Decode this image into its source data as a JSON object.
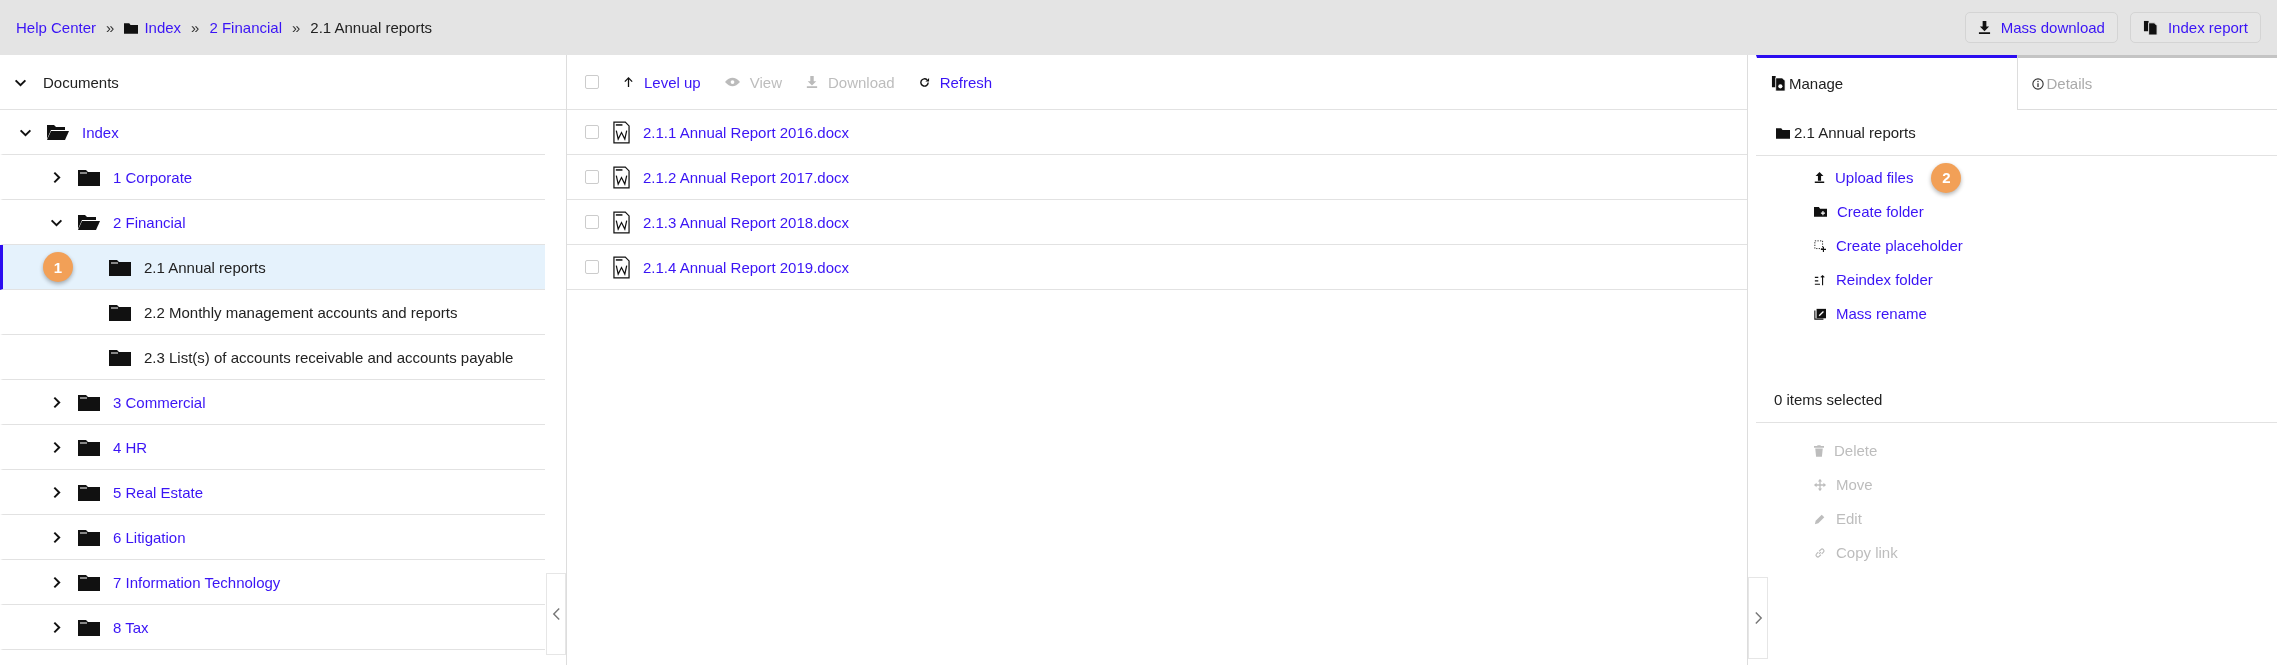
{
  "breadcrumb": {
    "separator": "»",
    "items": [
      {
        "label": "Help Center",
        "link": true,
        "folder_icon": false
      },
      {
        "label": "Index",
        "link": true,
        "folder_icon": true
      },
      {
        "label": "2 Financial",
        "link": true,
        "folder_icon": false
      },
      {
        "label": "2.1 Annual reports",
        "link": false,
        "folder_icon": false
      }
    ]
  },
  "header_buttons": [
    {
      "label": "Mass download",
      "kind": "download"
    },
    {
      "label": "Index report",
      "kind": "report"
    }
  ],
  "tree": {
    "title": "Documents",
    "expanded": true,
    "items": [
      {
        "label": "Index",
        "link": true,
        "selected": false,
        "expanded": true,
        "children": [
          {
            "label": "1 Corporate",
            "link": true,
            "selected": false,
            "expanded": false
          },
          {
            "label": "2 Financial",
            "link": true,
            "selected": false,
            "expanded": true,
            "children": [
              {
                "label": "2.1 Annual reports",
                "link": false,
                "selected": true,
                "callout": "1"
              },
              {
                "label": "2.2 Monthly management accounts and reports",
                "link": false,
                "selected": false
              },
              {
                "label": "2.3 List(s) of accounts receivable and accounts payable",
                "link": false,
                "selected": false
              }
            ]
          },
          {
            "label": "3 Commercial",
            "link": true,
            "selected": false,
            "expanded": false
          },
          {
            "label": "4 HR",
            "link": true,
            "selected": false,
            "expanded": false
          },
          {
            "label": "5 Real Estate",
            "link": true,
            "selected": false,
            "expanded": false
          },
          {
            "label": "6 Litigation",
            "link": true,
            "selected": false,
            "expanded": false
          },
          {
            "label": "7 Information Technology",
            "link": true,
            "selected": false,
            "expanded": false
          },
          {
            "label": "8 Tax",
            "link": true,
            "selected": false,
            "expanded": false
          }
        ]
      }
    ]
  },
  "toolbar": {
    "select_all_checked": false,
    "actions": [
      {
        "label": "Level up",
        "kind": "up",
        "disabled": false
      },
      {
        "label": "View",
        "kind": "view",
        "disabled": true
      },
      {
        "label": "Download",
        "kind": "download",
        "disabled": true
      },
      {
        "label": "Refresh",
        "kind": "refresh",
        "disabled": false
      }
    ]
  },
  "files": [
    {
      "name": "2.1.1 Annual Report 2016.docx",
      "checked": false
    },
    {
      "name": "2.1.2 Annual Report 2017.docx",
      "checked": false
    },
    {
      "name": "2.1.3 Annual Report 2018.docx",
      "checked": false
    },
    {
      "name": "2.1.4 Annual Report 2019.docx",
      "checked": false
    }
  ],
  "side_panel": {
    "tabs": [
      {
        "label": "Manage",
        "kind": "manage",
        "selected": true
      },
      {
        "label": "Details",
        "kind": "details",
        "selected": false
      }
    ],
    "folder": "2.1 Annual reports",
    "folder_actions": [
      {
        "label": "Upload files",
        "kind": "upload",
        "disabled": false,
        "callout": "2"
      },
      {
        "label": "Create folder",
        "kind": "folder",
        "disabled": false
      },
      {
        "label": "Create placeholder",
        "kind": "placeholder",
        "disabled": false
      },
      {
        "label": "Reindex folder",
        "kind": "reindex",
        "disabled": false
      },
      {
        "label": "Mass rename",
        "kind": "rename",
        "disabled": false
      }
    ],
    "selection_count": "0 items selected",
    "selection_actions": [
      {
        "label": "Delete",
        "kind": "delete",
        "disabled": true
      },
      {
        "label": "Move",
        "kind": "move",
        "disabled": true
      },
      {
        "label": "Edit",
        "kind": "edit",
        "disabled": true
      },
      {
        "label": "Copy link",
        "kind": "link",
        "disabled": true
      }
    ]
  }
}
